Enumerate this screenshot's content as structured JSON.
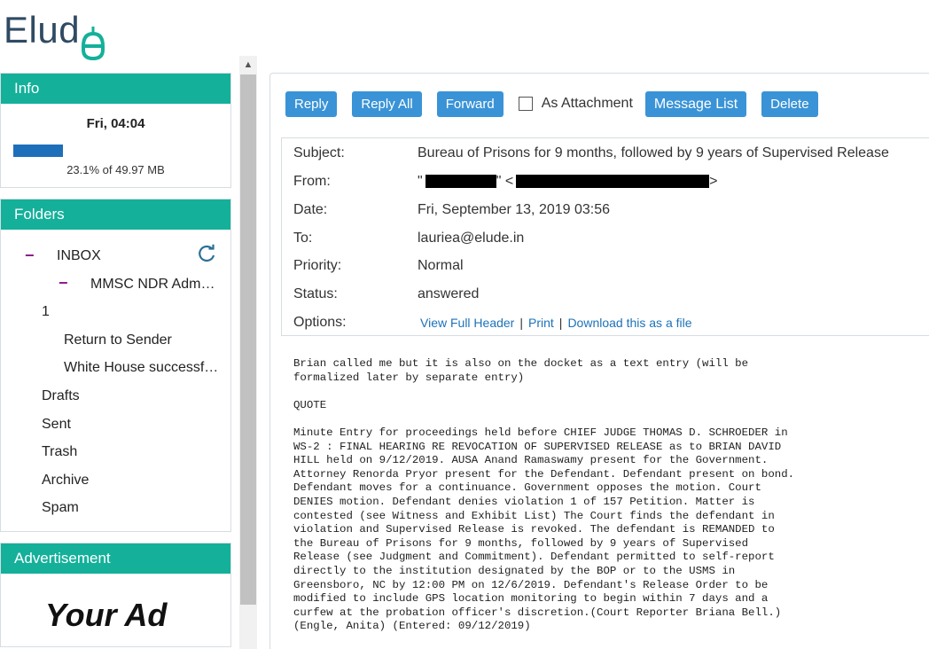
{
  "app": {
    "logo_text": "Elud",
    "logo_accent": "e",
    "brand_color": "#2f4a63",
    "accent_color": "#14b09a"
  },
  "info": {
    "title": "Info",
    "datetime": "Fri, 04:04",
    "quota_text": "23.1% of 49.97 MB",
    "quota_percent": 23.1
  },
  "folders": {
    "title": "Folders",
    "items": [
      {
        "label": "INBOX",
        "prefix": "−"
      },
      {
        "label": "MMSC NDR Adm…",
        "prefix": "−"
      },
      {
        "label": "1"
      },
      {
        "label": "Return to Sender"
      },
      {
        "label": "White House successf…"
      },
      {
        "label": "Drafts"
      },
      {
        "label": "Sent"
      },
      {
        "label": "Trash"
      },
      {
        "label": "Archive"
      },
      {
        "label": "Spam"
      }
    ]
  },
  "ad": {
    "title": "Advertisement",
    "text": "Your Ad"
  },
  "toolbar": {
    "reply": "Reply",
    "reply_all": "Reply All",
    "forward": "Forward",
    "as_attachment": "As Attachment",
    "message_list": "Message List",
    "delete": "Delete"
  },
  "message": {
    "labels": {
      "subject": "Subject:",
      "from": "From:",
      "date": "Date:",
      "to": "To:",
      "priority": "Priority:",
      "status": "Status:",
      "options": "Options:"
    },
    "subject": "Bureau of Prisons for 9 months, followed by 9 years of Supervised Release",
    "from_prefix": "\"",
    "from_mid": "\" <",
    "from_suffix": ">",
    "date": "Fri, September 13, 2019 03:56",
    "to": "lauriea@elude.in",
    "priority": "Normal",
    "status": "answered",
    "options": {
      "view_full_header": "View Full Header",
      "print": "Print",
      "download": "Download this as a file",
      "separator": "|"
    },
    "body": "Brian called me but it is also on the docket as a text entry (will be\nformalized later by separate entry)\n\nQUOTE\n\nMinute Entry for proceedings held before CHIEF JUDGE THOMAS D. SCHROEDER in\nWS-2 : FINAL HEARING RE REVOCATION OF SUPERVISED RELEASE as to BRIAN DAVID\nHILL held on 9/12/2019. AUSA Anand Ramaswamy present for the Government.\nAttorney Renorda Pryor present for the Defendant. Defendant present on bond.\nDefendant moves for a continuance. Government opposes the motion. Court\nDENIES motion. Defendant denies violation 1 of 157 Petition. Matter is\ncontested (see Witness and Exhibit List) The Court finds the defendant in\nviolation and Supervised Release is revoked. The defendant is REMANDED to\nthe Bureau of Prisons for 9 months, followed by 9 years of Supervised\nRelease (see Judgment and Commitment). Defendant permitted to self-report\ndirectly to the institution designated by the BOP or to the USMS in\nGreensboro, NC by 12:00 PM on 12/6/2019. Defendant's Release Order to be\nmodified to include GPS location monitoring to begin within 7 days and a\ncurfew at the probation officer's discretion.(Court Reporter Briana Bell.)\n(Engle, Anita) (Entered: 09/12/2019)"
  }
}
